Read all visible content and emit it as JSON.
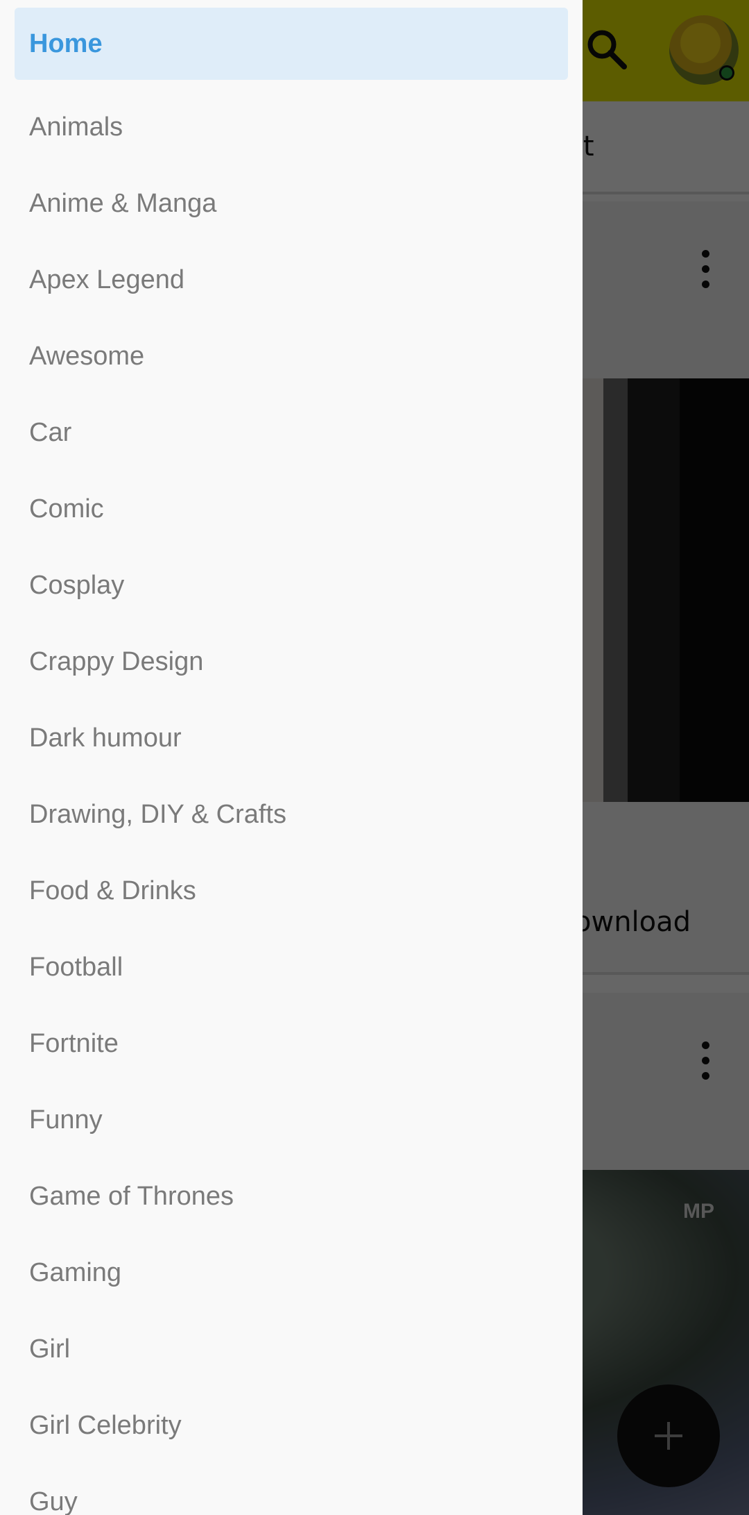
{
  "drawer": {
    "items": [
      {
        "label": "Home",
        "active": true
      },
      {
        "label": "Animals"
      },
      {
        "label": "Anime & Manga"
      },
      {
        "label": "Apex Legend"
      },
      {
        "label": "Awesome"
      },
      {
        "label": "Car"
      },
      {
        "label": "Comic"
      },
      {
        "label": "Cosplay"
      },
      {
        "label": "Crappy Design"
      },
      {
        "label": "Dark humour"
      },
      {
        "label": "Drawing, DIY & Crafts"
      },
      {
        "label": "Food & Drinks"
      },
      {
        "label": "Football"
      },
      {
        "label": "Fortnite"
      },
      {
        "label": "Funny"
      },
      {
        "label": "Game of Thrones"
      },
      {
        "label": "Gaming"
      },
      {
        "label": "Girl"
      },
      {
        "label": "Girl Celebrity"
      },
      {
        "label": "Guy"
      }
    ]
  },
  "background": {
    "tab_label_partial": "st",
    "download_partial": "ownload",
    "watermark": "MP"
  },
  "icons": {
    "search": "search-icon",
    "more": "more-vert-icon",
    "add": "plus-icon",
    "avatar": "avatar"
  },
  "colors": {
    "topbar": "#e6e600",
    "active_text": "#3a97dd",
    "active_bg": "#dfedf9",
    "item_text": "#7a7a7a"
  }
}
